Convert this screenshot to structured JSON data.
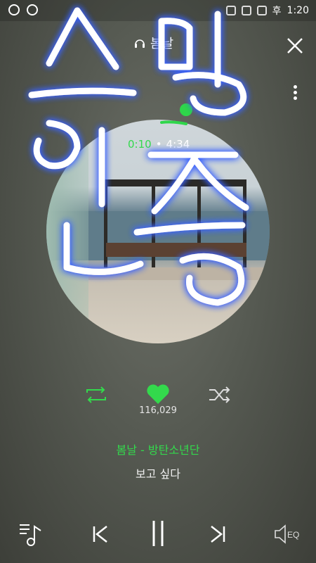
{
  "status": {
    "time": "1:20",
    "ampm": "후"
  },
  "header": {
    "title": "봄날"
  },
  "progress": {
    "current": "0:10",
    "separator": "•",
    "total": "4:34",
    "fraction": 0.037
  },
  "likes": {
    "count": "116,029"
  },
  "song": {
    "title": "봄날 - 방탄소년단",
    "lyric": "보고 싶다"
  },
  "overlay": {
    "handwriting": "스밍 인증"
  },
  "icons": [
    "close-icon",
    "more-icon",
    "repeat-icon",
    "heart-icon",
    "shuffle-icon",
    "playlist-icon",
    "previous-icon",
    "pause-icon",
    "next-icon",
    "eq-icon"
  ],
  "colors": {
    "accent": "#33d94c"
  }
}
